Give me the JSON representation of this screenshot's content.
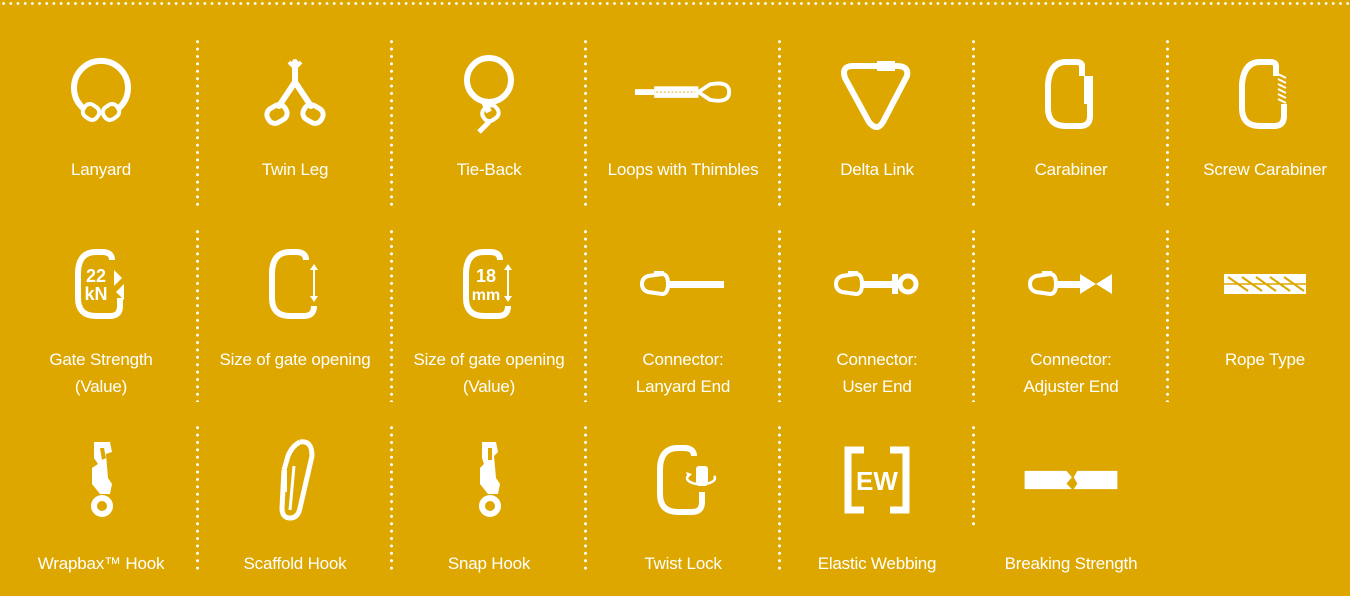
{
  "legend": {
    "row1": [
      {
        "label": "Lanyard",
        "icon": "lanyard-icon"
      },
      {
        "label": "Twin Leg",
        "icon": "twin-leg-icon"
      },
      {
        "label": "Tie-Back",
        "icon": "tie-back-icon"
      },
      {
        "label": "Loops with Thimbles",
        "icon": "loops-with-thimbles-icon"
      },
      {
        "label": "Delta Link",
        "icon": "delta-link-icon"
      },
      {
        "label": "Carabiner",
        "icon": "carabiner-icon"
      },
      {
        "label": "Screw Carabiner",
        "icon": "screw-carabiner-icon"
      }
    ],
    "row2": [
      {
        "label_line1": "Gate Strength",
        "label_line2": "(Value)",
        "icon": "gate-strength-icon",
        "icon_text_top": "22",
        "icon_text_bottom": "kN"
      },
      {
        "label_line1": "Size of gate opening",
        "label_line2": "",
        "icon": "gate-opening-icon"
      },
      {
        "label_line1": "Size of gate opening",
        "label_line2": "(Value)",
        "icon": "gate-opening-value-icon",
        "icon_text_top": "18",
        "icon_text_bottom": "mm"
      },
      {
        "label_line1": "Connector:",
        "label_line2": "Lanyard End",
        "icon": "connector-lanyard-end-icon"
      },
      {
        "label_line1": "Connector:",
        "label_line2": "User End",
        "icon": "connector-user-end-icon"
      },
      {
        "label_line1": "Connector:",
        "label_line2": "Adjuster End",
        "icon": "connector-adjuster-end-icon"
      },
      {
        "label_line1": "Rope Type",
        "label_line2": "",
        "icon": "rope-type-icon"
      }
    ],
    "row3": [
      {
        "label": "Wrapbax™ Hook",
        "icon": "wrapbax-hook-icon"
      },
      {
        "label": "Scaffold Hook",
        "icon": "scaffold-hook-icon"
      },
      {
        "label": "Snap Hook",
        "icon": "snap-hook-icon"
      },
      {
        "label": "Twist Lock",
        "icon": "twist-lock-icon"
      },
      {
        "label": "Elastic Webbing",
        "icon": "elastic-webbing-icon",
        "icon_text": "EW"
      },
      {
        "label": "Breaking Strength",
        "icon": "breaking-strength-icon"
      }
    ]
  },
  "colors": {
    "background": "#DDA700",
    "foreground": "#FFFFFF"
  }
}
